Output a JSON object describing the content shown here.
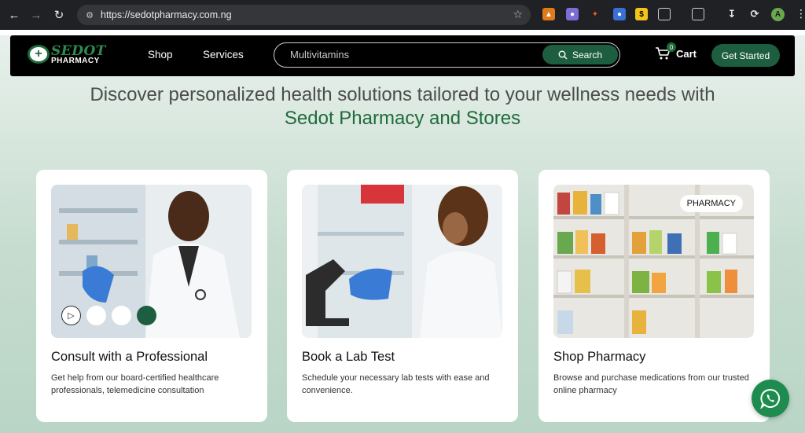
{
  "browser": {
    "url": "https://sedotpharmacy.com.ng",
    "profile_initial": "A"
  },
  "header": {
    "logo_top": "SEDOT",
    "logo_bottom": "PHARMACY",
    "nav": [
      "Shop",
      "Services"
    ],
    "search_value": "Multivitamins",
    "search_button": "Search",
    "cart_count": "0",
    "cart_label": "Cart",
    "cta": "Get Started"
  },
  "hero": {
    "line1": "Discover personalized health solutions tailored to your wellness needs with",
    "line2": "Sedot Pharmacy and Stores"
  },
  "cards": [
    {
      "title": "Consult with a Professional",
      "desc": "Get help from our board-certified healthcare professionals, telemedicine consultation"
    },
    {
      "title": "Book a Lab Test",
      "desc": "Schedule your necessary lab tests with ease and convenience."
    },
    {
      "title": "Shop Pharmacy",
      "desc": "Browse and purchase medications from our trusted online pharmacy",
      "tag": "PHARMACY"
    }
  ],
  "colors": {
    "brand_green": "#1e5e40",
    "headline_green": "#1f6b3c",
    "whatsapp": "#1e8c4e"
  }
}
